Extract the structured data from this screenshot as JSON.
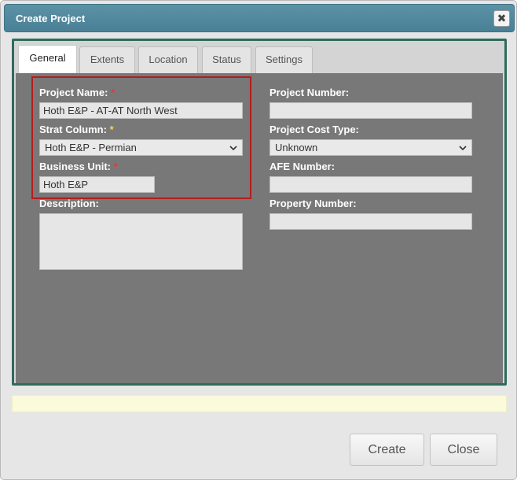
{
  "dialog": {
    "title": "Create Project",
    "close_glyph": "✖"
  },
  "tabs": [
    {
      "label": "General",
      "active": true
    },
    {
      "label": "Extents"
    },
    {
      "label": "Location"
    },
    {
      "label": "Status"
    },
    {
      "label": "Settings"
    }
  ],
  "form": {
    "project_name": {
      "label": "Project Name:",
      "required": "*",
      "value": "Hoth E&P - AT-AT North West"
    },
    "strat_column": {
      "label": "Strat Column:",
      "required": "*",
      "value": "Hoth E&P - Permian"
    },
    "business_unit": {
      "label": "Business Unit:",
      "required": "*",
      "value": "Hoth E&P"
    },
    "description": {
      "label": "Description:",
      "value": ""
    },
    "project_number": {
      "label": "Project Number:",
      "value": ""
    },
    "project_cost_type": {
      "label": "Project Cost Type:",
      "value": "Unknown"
    },
    "afe_number": {
      "label": "AFE Number:",
      "value": ""
    },
    "property_number": {
      "label": "Property Number:",
      "value": ""
    }
  },
  "buttons": {
    "create": "Create",
    "close": "Close"
  },
  "colors": {
    "titlebar": "#4f879c",
    "frame_border": "#2e6b5c",
    "panel": "#787878",
    "highlight_border": "#b51c1c",
    "required_red": "#e03a3a",
    "required_yellow": "#ffd23d",
    "status_bar": "#fbfbdb"
  },
  "icons": {
    "close": "close-icon",
    "select_arrow": "chevron-down-icon"
  }
}
